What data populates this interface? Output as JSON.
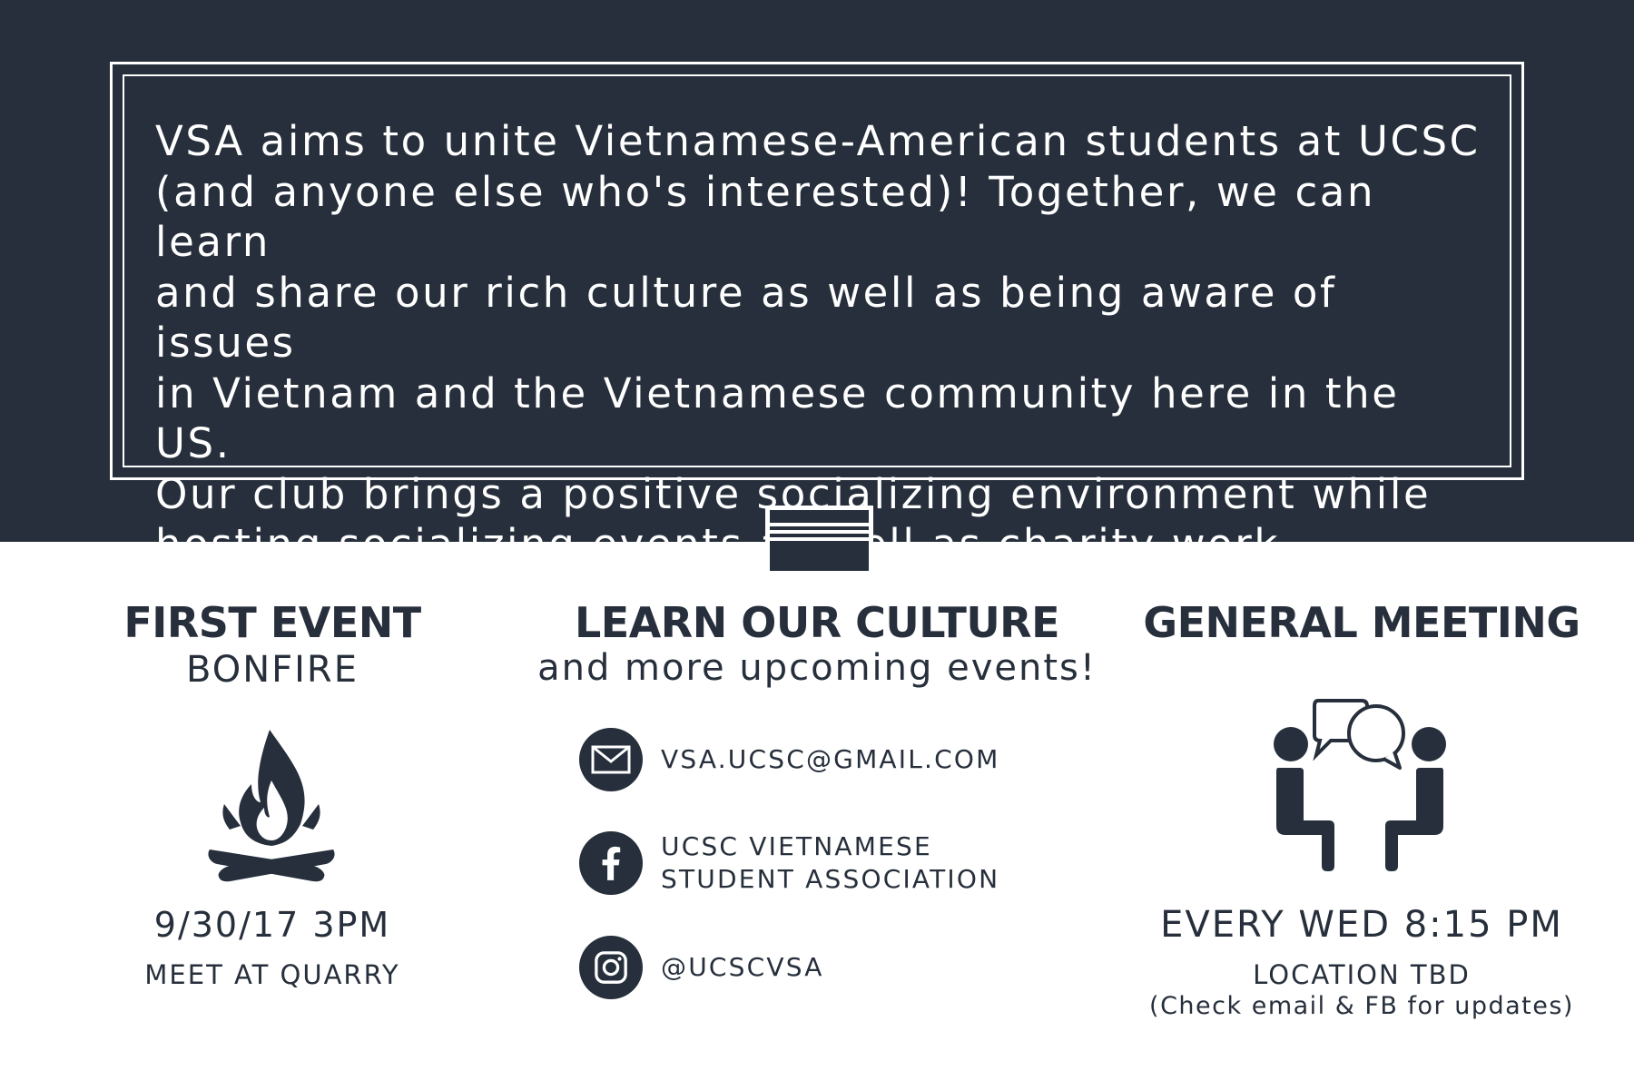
{
  "mission": {
    "lines": [
      "VSA aims to unite Vietnamese-American students at UCSC",
      "(and anyone else who's interested)! Together, we can learn",
      "and share our rich culture as well as being aware of issues",
      "in Vietnam and the Vietnamese community here in the US.",
      "Our club brings a positive socializing environment while",
      "hosting socializing events as well as charity work."
    ]
  },
  "first_event": {
    "heading": "FIRST EVENT",
    "subtitle": "BONFIRE",
    "icon": "campfire-icon",
    "datetime": "9/30/17  3PM",
    "location": "MEET AT QUARRY"
  },
  "culture": {
    "heading": "LEARN OUR CULTURE",
    "subtitle": "and more upcoming events!",
    "contacts": {
      "email": {
        "icon": "email-icon",
        "text": "VSA.UCSC@GMAIL.COM"
      },
      "facebook": {
        "icon": "facebook-icon",
        "line1": "UCSC VIETNAMESE",
        "line2": "STUDENT ASSOCIATION"
      },
      "instagram": {
        "icon": "instagram-icon",
        "text": "@UCSCVSA"
      }
    }
  },
  "general_meeting": {
    "heading": "GENERAL MEETING",
    "icon": "conversation-icon",
    "schedule": "EVERY WED  8:15 PM",
    "location": "LOCATION TBD",
    "note": "(Check email & FB for updates)"
  },
  "colors": {
    "navy": "#262f3b",
    "white": "#ffffff"
  }
}
